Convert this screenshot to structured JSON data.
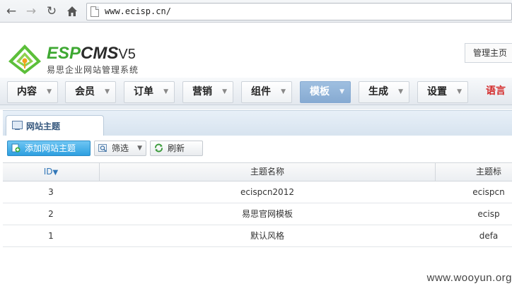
{
  "browser": {
    "url": "www.ecisp.cn/",
    "back_icon": "arrow-left-icon",
    "forward_icon": "arrow-right-icon",
    "reload_icon": "reload-icon",
    "home_icon": "home-icon"
  },
  "header": {
    "logo_esp": "ESP",
    "logo_cms": "CMS",
    "logo_version": "V5",
    "logo_subtitle": "易思企业网站管理系统",
    "admin_home": "管理主页"
  },
  "menu": {
    "items": [
      {
        "label": "内容"
      },
      {
        "label": "会员"
      },
      {
        "label": "订单"
      },
      {
        "label": "营销"
      },
      {
        "label": "组件"
      },
      {
        "label": "模板",
        "active": true
      },
      {
        "label": "生成"
      },
      {
        "label": "设置"
      },
      {
        "label": "语言"
      }
    ]
  },
  "panel": {
    "tab_label": "网站主题",
    "toolbar": {
      "add_label": "添加网站主题",
      "filter_label": "筛选",
      "refresh_label": "刷新"
    },
    "table": {
      "columns": [
        "ID",
        "主题名称",
        "主题标"
      ],
      "rows": [
        {
          "id": "3",
          "name": "ecispcn2012",
          "code": "ecispcn"
        },
        {
          "id": "2",
          "name": "易思官网模板",
          "code": "ecisp"
        },
        {
          "id": "1",
          "name": "默认风格",
          "code": "defa"
        }
      ]
    }
  },
  "watermark": "www.wooyun.org",
  "colors": {
    "brand_green": "#3ea832",
    "active_menu": "#8fb3d9",
    "primary_button": "#2d9fe0",
    "language_red": "#d42a2a"
  }
}
